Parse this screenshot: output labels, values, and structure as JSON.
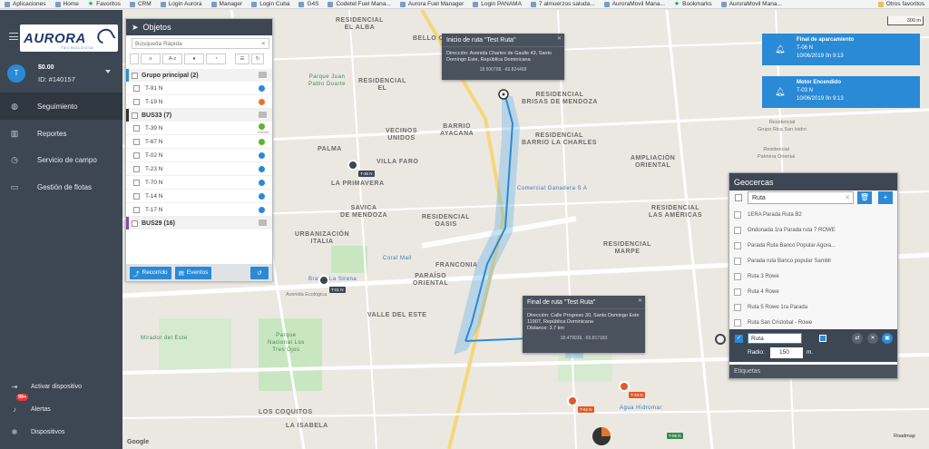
{
  "bookmarks": {
    "items": [
      "Aplicaciones",
      "Home",
      "Favoritos",
      "CRM",
      "Login Aurora",
      "Manager",
      "Login Cuba",
      "G4S",
      "Codetel Fuel Mana...",
      "Aurora Fuel Manager",
      "Login PANAMA",
      "7 almuerzos saluda...",
      "AuroraMovil Mana...",
      "Bookmarks",
      "AuroraMovil Mana..."
    ],
    "other": "Otros favoritos"
  },
  "brand": {
    "name": "AURORA",
    "sub": "TECNOLOGÍA"
  },
  "account": {
    "initial": "T",
    "balance": "$0.00",
    "id": "ID: #140157"
  },
  "nav": {
    "seguimiento": "Seguimiento",
    "reportes": "Reportes",
    "servicio": "Servicio de campo",
    "flotas": "Gestión de flotas"
  },
  "bottom_nav": {
    "activar": "Activar dispositivo",
    "alertas": "Alertas",
    "alert_count": "99+",
    "dispositivos": "Dispositivos"
  },
  "objetos": {
    "title": "Objetos",
    "search_placeholder": "Búsqueda Rápida",
    "tools": {
      "az": "A-z"
    },
    "groups": [
      {
        "name": "Grupo principal (2)",
        "color": "#2a8ad6",
        "rows": [
          {
            "name": "T-91 N",
            "status": "#2a8ad6",
            "speed": ""
          },
          {
            "name": "T-19 N",
            "status": "#e8742a",
            "speed": ""
          }
        ]
      },
      {
        "name": "BUS33 (7)",
        "color": "#333333",
        "rows": [
          {
            "name": "T-39 N",
            "status": "#5ab52a",
            "speed": "4 km/h"
          },
          {
            "name": "T-67 N",
            "status": "#5ab52a",
            "speed": ""
          },
          {
            "name": "T-02 N",
            "status": "#2a8ad6",
            "speed": ""
          },
          {
            "name": "T-23 N",
            "status": "#2a8ad6",
            "speed": ""
          },
          {
            "name": "T-70 N",
            "status": "#2a8ad6",
            "speed": ""
          },
          {
            "name": "T-14 N",
            "status": "#2a8ad6",
            "speed": ""
          },
          {
            "name": "T-17 N",
            "status": "#2a8ad6",
            "speed": ""
          }
        ]
      },
      {
        "name": "BUS29 (16)",
        "color": "#8e44ad",
        "rows": []
      }
    ],
    "footer": {
      "recorrido": "Recorrido",
      "eventos": "Eventos"
    }
  },
  "popup_inicio": {
    "title": "Inicio de ruta \"Test Ruta\"",
    "address": "Dirección: Avenida Charles de Gaulle 43, Santo Domingo Este, República Dominicana",
    "coords": "18.500768, -69.824468"
  },
  "popup_final": {
    "title": "Final de ruta \"Test Ruta\"",
    "address": "Dirección: Calle Progreso 30, Santo Domingo Este 11907, República Dominicana",
    "distance": "Distance: 3.7 km",
    "coords": "18.479039, -69.817183"
  },
  "alerts": [
    {
      "title": "Final de aparcamiento",
      "vehicle": "T-06 N",
      "date": "10/06/2019 0n 9:13"
    },
    {
      "title": "Motor Encendido",
      "vehicle": "T-03 N",
      "date": "10/06/2019 0n 9:13"
    }
  ],
  "geocercas": {
    "title": "Geocercas",
    "search": "Ruta",
    "items": [
      "1ERA Parada Ruta B2",
      "Ondonada 1ra Parada ruta 7 ROWE",
      "Parada Ruta Banco Popular Agora...",
      "Parada ruta Banco popular Sambil",
      "Ruta 3 Rowe",
      "Ruta 4 Rowe",
      "Ruta 5 Rowe 1ra Parada",
      "Ruta San Cristobal - Rowe"
    ],
    "edit_name": "Ruta",
    "radio_label": "Radio:",
    "radio_value": "150",
    "unit": "m.",
    "etiquetas": "Etiquetas"
  },
  "map": {
    "scale": "300 m",
    "roadmap": "Roadmap",
    "google": "Google",
    "labels": {
      "alba": "RESIDENCIAL\nEL ALBA",
      "bello": "BELLO CAMPO",
      "juan": "Parque Juan\nPablo Duarte",
      "residencial_el": "RESIDENCIAL\nEL",
      "vecinos": "VECINOS\nUNIDOS",
      "barrio": "BARRIO\nAYACANA",
      "charles": "RESIDENCIAL\nBARRIO LA CHARLES",
      "mendoza": "RESIDENCIAL\nBRISAS DE MENDOZA",
      "palma": "PALMA",
      "villa": "VILLA FARO",
      "primavera": "LA PRIMAVERA",
      "savica": "SAVICA\nDE MENDOZA",
      "italia": "URBANIZACIÓN\nITALIA",
      "oasis": "RESIDENCIAL\nOASIS",
      "ganadera": "Comercial Ganadera S A",
      "coral": "Coral Mall",
      "franconia": "FRANCONIA",
      "paraiso": "PARAÍSO\nORIENTAL",
      "valle": "VALLE DEL ESTE",
      "lasamericas": "RESIDENCIAL\nLAS AMÉRICAS",
      "oriental": "AMPLIACIÓN\nORIENTAL",
      "laviquela": "RESIDENCIAL\nLA VIGUELA",
      "moderna": "RESIDENCIAL\nMARPE",
      "laisabela": "LA ISABELITA",
      "coquitos": "LOS COQUITOS",
      "isabela": "LA ISABELA",
      "sector": "SECTOR\nLA ISABELITA",
      "tres": "Parque\nNacional Los\nTres Ojos",
      "mirador": "Mirador del Este",
      "hidromar": "Agua Hidromar",
      "sirena": "La Sirena",
      "bravo": "Bravo",
      "ecologica": "Avenida Ecológica",
      "palmera": "Residencial\nPalmera Oriental",
      "rica": "Residencial\nGrupo Rica San Isidro"
    },
    "vehicles": [
      {
        "label": "T-35 N",
        "kind": "dark"
      },
      {
        "label": "T-01 N",
        "kind": "dark"
      },
      {
        "label": "T-49 N",
        "kind": "red"
      },
      {
        "label": "T-62 N",
        "kind": "red"
      },
      {
        "label": "T-06 N",
        "kind": "green"
      }
    ]
  },
  "colors": {
    "accent": "#2a8ad6",
    "sidebar": "#3d4653",
    "route": "#2a8ad6"
  }
}
